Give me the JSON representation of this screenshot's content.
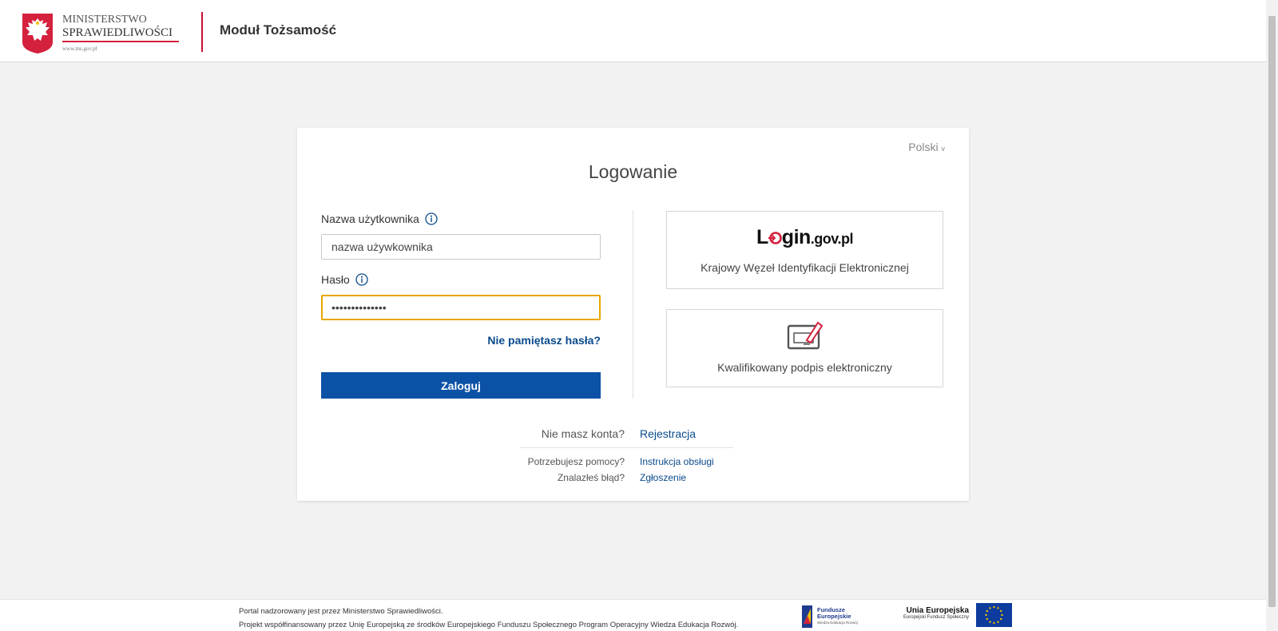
{
  "header": {
    "logo_line1": "MINISTERSTWO",
    "logo_line2": "SPRAWIEDLIWOŚCI",
    "logo_url": "www.ms.gov.pl",
    "module_title": "Moduł Tożsamość"
  },
  "login": {
    "language": "Polski",
    "title": "Logowanie",
    "username_label": "Nazwa użytkownika",
    "username_value": "nazwa używkownika",
    "password_label": "Hasło",
    "password_value": "••••••••••••••",
    "forgot_link": "Nie pamiętasz hasła?",
    "submit_label": "Zaloguj"
  },
  "options": {
    "logingov_brand_l": "L",
    "logingov_brand_gin": "gin",
    "logingov_brand_domain": ".gov.pl",
    "logingov_label": "Krajowy Węzeł Identyfikacji Elektronicznej",
    "signature_label": "Kwalifikowany podpis elektroniczny"
  },
  "links": {
    "register_q": "Nie masz konta?",
    "register_a": "Rejestracja",
    "help_q": "Potrzebujesz pomocy?",
    "help_a": "Instrukcja obsługi",
    "bug_q": "Znalazłeś błąd?",
    "bug_a": "Zgłoszenie"
  },
  "footer": {
    "line1": "Portal nadzorowany jest przez Ministerstwo Sprawiedliwości.",
    "line2": "Projekt współfinansowany przez Unię Europejską ze środków Europejskiego Funduszu Społecznego Program Operacyjny Wiedza Edukacja Rozwój.",
    "fe_line1": "Fundusze",
    "fe_line2": "Europejskie",
    "fe_line3": "Wiedza Edukacja Rozwój",
    "ue_line1": "Unia Europejska",
    "ue_line2": "Europejski Fundusz Społeczny"
  },
  "colors": {
    "primary_button": "#0b52a6",
    "link": "#0a4a8c",
    "focus_border": "#e7a700",
    "accent_red": "#c8102e"
  }
}
